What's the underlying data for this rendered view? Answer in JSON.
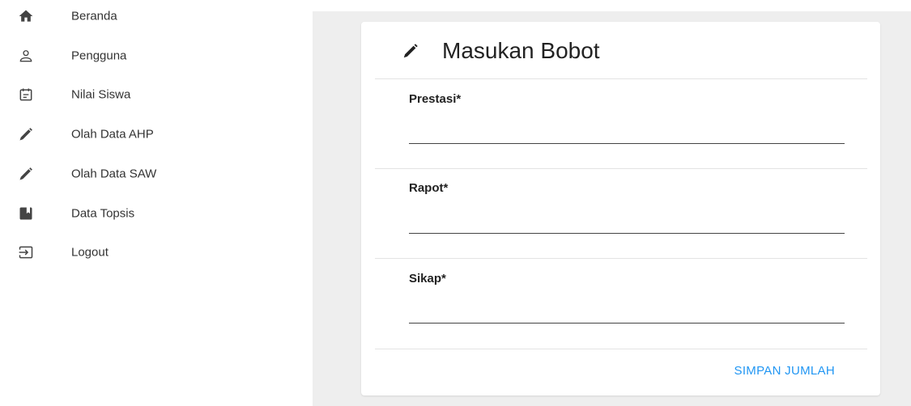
{
  "sidebar": {
    "items": [
      {
        "label": "Beranda",
        "icon": "home-icon"
      },
      {
        "label": "Pengguna",
        "icon": "person-icon"
      },
      {
        "label": "Nilai Siswa",
        "icon": "event-note-icon"
      },
      {
        "label": "Olah Data AHP",
        "icon": "pencil-icon"
      },
      {
        "label": "Olah Data SAW",
        "icon": "pencil-icon"
      },
      {
        "label": "Data Topsis",
        "icon": "bookmark-icon"
      },
      {
        "label": "Logout",
        "icon": "logout-icon"
      }
    ]
  },
  "form": {
    "title": "Masukan Bobot",
    "title_icon": "pencil-icon",
    "fields": [
      {
        "label": "Prestasi*",
        "value": ""
      },
      {
        "label": "Rapot*",
        "value": ""
      },
      {
        "label": "Sikap*",
        "value": ""
      }
    ],
    "submit_label": "SIMPAN JUMLAH"
  },
  "colors": {
    "accent": "#2196f3",
    "background": "#eeeeee",
    "icon": "#444444"
  }
}
